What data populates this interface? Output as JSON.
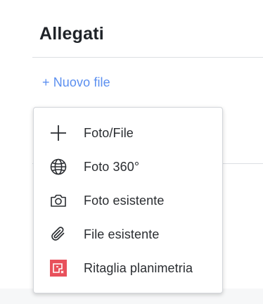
{
  "section": {
    "title": "Allegati",
    "new_file_label": "+ Nuovo file"
  },
  "menu": {
    "items": [
      {
        "label": "Foto/File",
        "icon": "plus-icon"
      },
      {
        "label": "Foto 360°",
        "icon": "globe-icon"
      },
      {
        "label": "Foto esistente",
        "icon": "camera-icon"
      },
      {
        "label": "File esistente",
        "icon": "paperclip-icon"
      },
      {
        "label": "Ritaglia planimetria",
        "icon": "crop-floorplan-icon"
      }
    ]
  },
  "colors": {
    "link": "#5b8ff0",
    "crop_icon_bg": "#e8505b",
    "text": "#2a2d31"
  }
}
